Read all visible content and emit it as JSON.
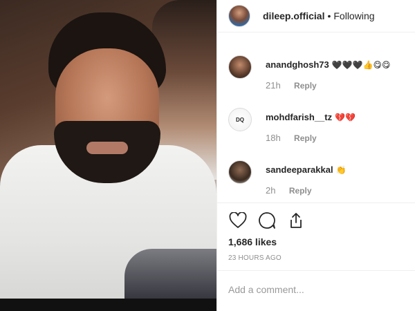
{
  "post": {
    "username": "dileep.official",
    "separator": "•",
    "follow_status": "Following"
  },
  "comments": [
    {
      "username": "anandghosh73",
      "text": "🖤🖤🖤👍😋😋",
      "time": "21h",
      "reply_label": "Reply"
    },
    {
      "username": "mohdfarish__tz",
      "text": "💔💔",
      "time": "18h",
      "reply_label": "Reply",
      "avatar_text": "DQ"
    },
    {
      "username": "sandeeparakkal",
      "text": "👏",
      "time": "2h",
      "reply_label": "Reply"
    }
  ],
  "actions": {
    "icons": [
      "heart-icon",
      "comment-icon",
      "share-icon"
    ]
  },
  "likes": "1,686 likes",
  "posted_ago": "23 HOURS AGO",
  "add_comment_placeholder": "Add a comment..."
}
